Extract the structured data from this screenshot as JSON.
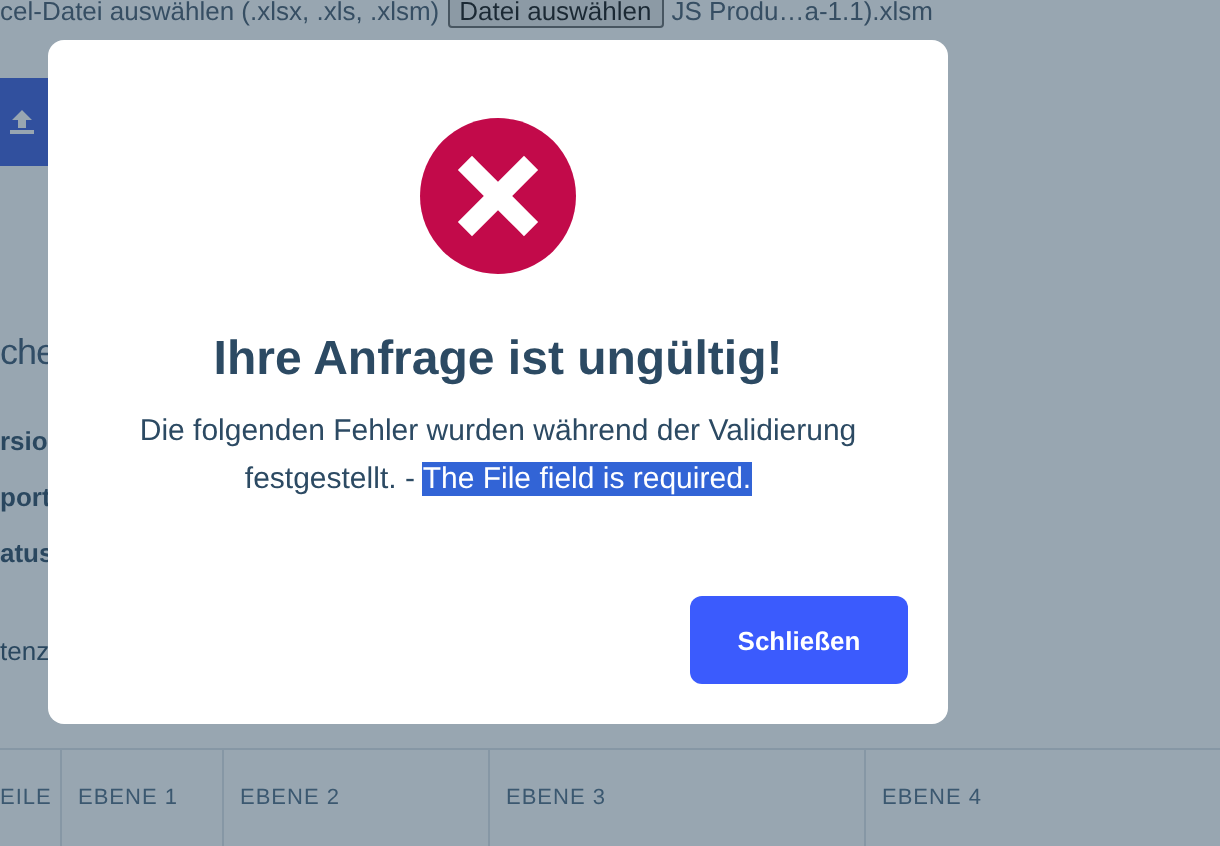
{
  "page": {
    "file_label": "cel-Datei auswählen (.xlsx, .xls, .xlsm)",
    "file_button": "Datei auswählen",
    "file_name": "JS Produ…a-1.1).xlsm",
    "heading": "che",
    "fields": [
      "rsio",
      "port",
      "atus"
    ],
    "note": "tenz",
    "table": {
      "columns": [
        "EILE",
        "EBENE 1",
        "EBENE 2",
        "EBENE 3",
        "EBENE 4"
      ]
    }
  },
  "dialog": {
    "kind": "error",
    "title": "Ihre Anfrage ist ungültig!",
    "message": "Die folgenden Fehler wurden während der Validierung festgestellt. -",
    "highlighted": "The File field is required.",
    "button": "Schließen"
  }
}
